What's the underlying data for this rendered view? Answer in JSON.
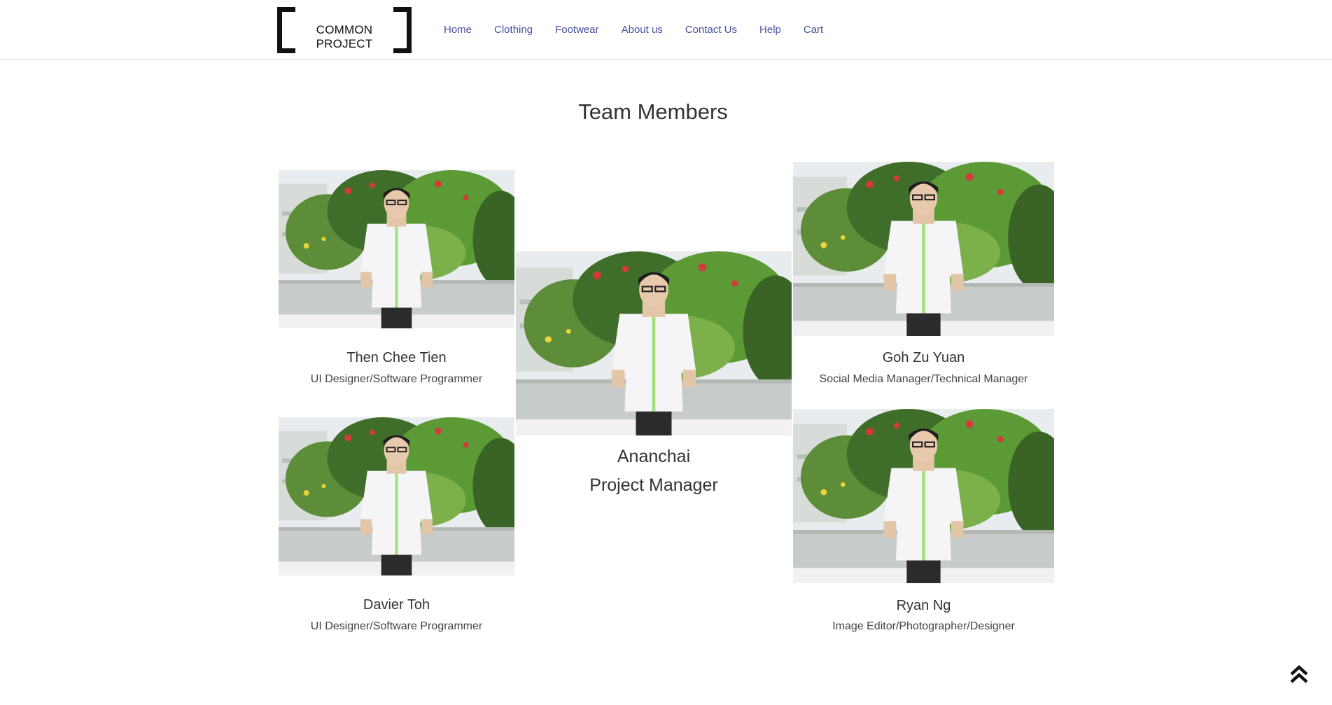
{
  "brand": {
    "logo_text": "COMMON PROJECT"
  },
  "nav": {
    "items": [
      "Home",
      "Clothing",
      "Footwear",
      "About us",
      "Contact Us",
      "Help",
      "Cart"
    ]
  },
  "page": {
    "title": "Team Members"
  },
  "members": [
    {
      "name": "Then Chee Tien",
      "role": "UI Designer/Software Programmer"
    },
    {
      "name": "Ananchai",
      "role": "Project Manager"
    },
    {
      "name": "Goh Zu Yuan",
      "role": "Social Media Manager/Technical Manager"
    },
    {
      "name": "Davier Toh",
      "role": "UI Designer/Software Programmer"
    },
    {
      "name": "Ryan Ng",
      "role": "Image Editor/Photographer/Designer"
    }
  ],
  "icons": {
    "scroll_top": "double-chevron-up-icon"
  },
  "colors": {
    "nav_link": "#4a4fa0",
    "text": "#333333",
    "background": "#ffffff"
  }
}
